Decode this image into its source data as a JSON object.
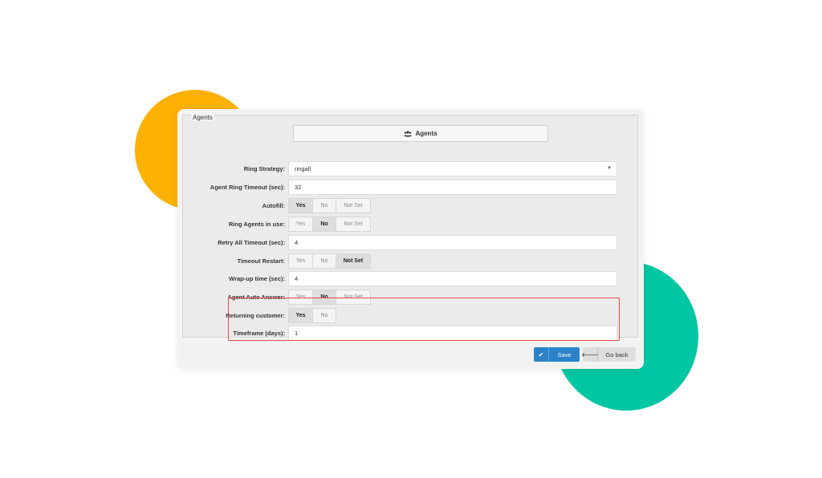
{
  "colors": {
    "accent_orange": "#FDB103",
    "accent_green": "#00C7A3",
    "save_blue": "#2B82C9",
    "highlight_red": "#E34B3B"
  },
  "panel": {
    "legend": "Agents",
    "tab_label": "Agents",
    "tab_icon": "users-icon"
  },
  "fields": {
    "ring_strategy": {
      "label": "Ring Strategy:",
      "value": "ringall"
    },
    "agent_ring_timeout": {
      "label": "Agent Ring Timeout (sec):",
      "value": "32"
    },
    "autofill": {
      "label": "Autofill:",
      "options": [
        "Yes",
        "No",
        "Not Set"
      ],
      "selected": "Yes"
    },
    "ring_agents_in_use": {
      "label": "Ring Agents in use:",
      "options": [
        "Yes",
        "No",
        "Not Set"
      ],
      "selected": "No"
    },
    "retry_all_timeout": {
      "label": "Retry All Timeout (sec):",
      "value": "4"
    },
    "timeout_restart": {
      "label": "Timeout Restart:",
      "options": [
        "Yes",
        "No",
        "Not Set"
      ],
      "selected": "Not Set"
    },
    "wrapup_time": {
      "label": "Wrap-up time (sec):",
      "value": "4"
    },
    "agent_auto_answer": {
      "label": "Agent Auto Answer:",
      "options": [
        "Yes",
        "No",
        "Not Set"
      ],
      "selected": "No"
    },
    "returning_customer": {
      "label": "Returning customer:",
      "options": [
        "Yes",
        "No"
      ],
      "selected": "Yes"
    },
    "timeframe_days": {
      "label": "Timeframe (days):",
      "value": "1"
    }
  },
  "buttons": {
    "save": "Save",
    "go_back": "Go back"
  }
}
